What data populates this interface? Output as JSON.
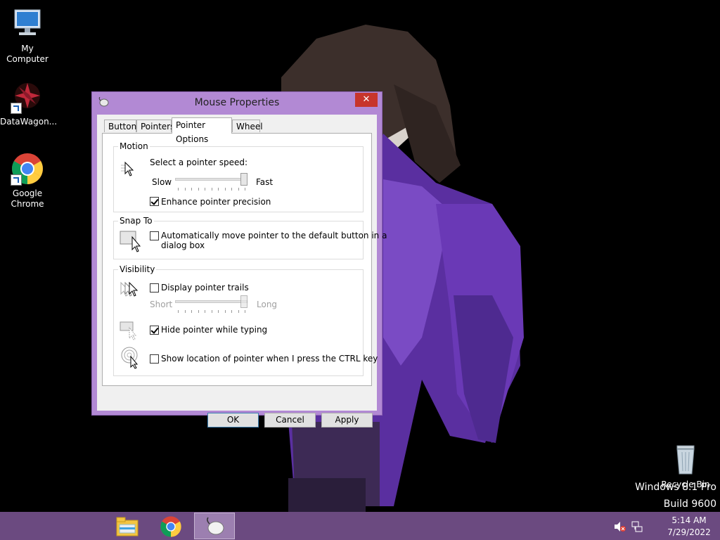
{
  "desktop": {
    "icons": [
      {
        "label": "My Computer",
        "icon": "computer-icon"
      },
      {
        "label": "DataWagon...",
        "icon": "datawagon-icon"
      },
      {
        "label": "Google Chrome",
        "icon": "chrome-icon"
      },
      {
        "label": "Recycle Bin",
        "icon": "recycle-bin-icon"
      }
    ],
    "watermark": {
      "line1": "Windows 8.1 Pro",
      "line2": "Build 9600"
    }
  },
  "dialog": {
    "title": "Mouse Properties",
    "close_label": "✕",
    "tabs": [
      "Buttons",
      "Pointers",
      "Pointer Options",
      "Wheel"
    ],
    "active_tab": "Pointer Options",
    "motion": {
      "group_label": "Motion",
      "speed_label": "Select a pointer speed:",
      "slow_label": "Slow",
      "fast_label": "Fast",
      "speed_value": 1.0,
      "enhance_label": "Enhance pointer precision",
      "enhance_checked": true
    },
    "snap_to": {
      "group_label": "Snap To",
      "auto_move_label_line1": "Automatically move pointer to the default button in a",
      "auto_move_label_line2": "dialog box",
      "auto_move_checked": false
    },
    "visibility": {
      "group_label": "Visibility",
      "trails_label": "Display pointer trails",
      "trails_checked": false,
      "short_label": "Short",
      "long_label": "Long",
      "trails_value": 1.0,
      "hide_label": "Hide pointer while typing",
      "hide_checked": true,
      "ctrl_label": "Show location of pointer when I press the CTRL key",
      "ctrl_checked": false
    },
    "buttons": {
      "ok": "OK",
      "cancel": "Cancel",
      "apply": "Apply"
    }
  },
  "taskbar": {
    "apps": [
      {
        "name": "File Explorer",
        "icon": "file-explorer-icon",
        "active": false
      },
      {
        "name": "Google Chrome",
        "icon": "chrome-icon",
        "active": false
      },
      {
        "name": "Mouse Properties",
        "icon": "mouse-icon",
        "active": true
      }
    ],
    "tray": {
      "time": "5:14 AM",
      "date": "7/29/2022"
    }
  },
  "colors": {
    "taskbar": "#6b4a80",
    "dialog_frame": "#b289d4",
    "close_button": "#c7352b",
    "default_button_border": "#3c7fb1"
  }
}
